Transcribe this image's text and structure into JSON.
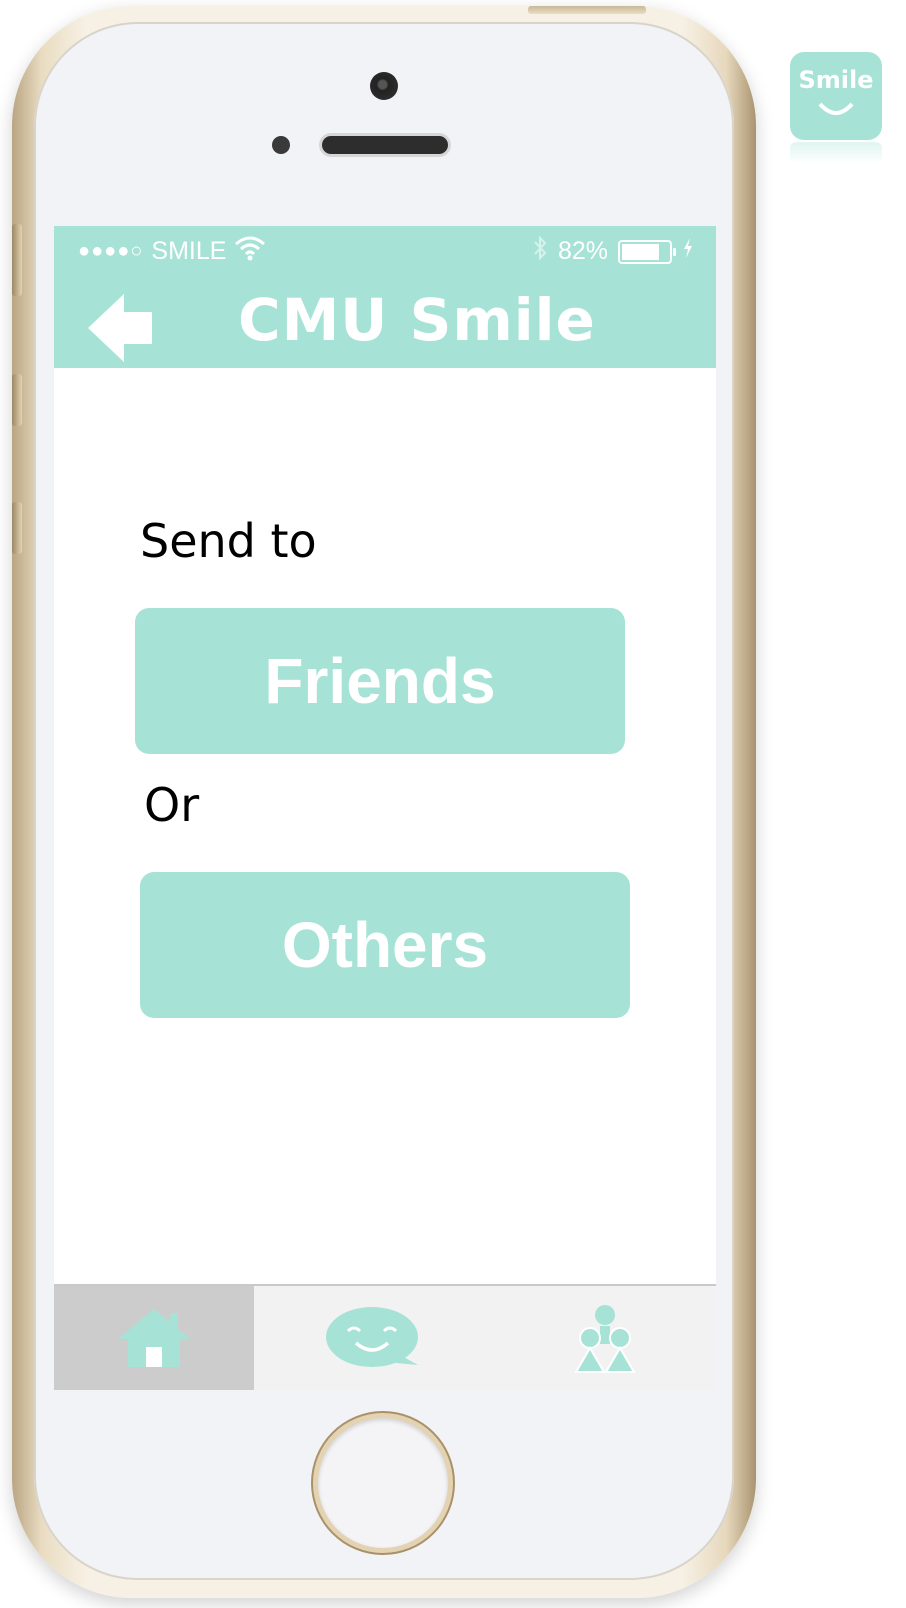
{
  "status_bar": {
    "signal": "●●●●○",
    "carrier": "SMILE",
    "battery_percent": "82%",
    "battery_level": 0.82
  },
  "nav": {
    "title": "CMU Smile"
  },
  "main": {
    "send_to_label": "Send to",
    "friends_button": "Friends",
    "or_label": "Or",
    "others_button": "Others"
  },
  "tabbar": {
    "tabs": [
      {
        "icon": "home-icon",
        "active": true
      },
      {
        "icon": "smile-chat-icon",
        "active": false
      },
      {
        "icon": "people-icon",
        "active": false
      }
    ]
  },
  "app_icon": {
    "label": "Smile"
  },
  "colors": {
    "accent": "#a6e3d6",
    "active_tab": "#cccccc"
  }
}
